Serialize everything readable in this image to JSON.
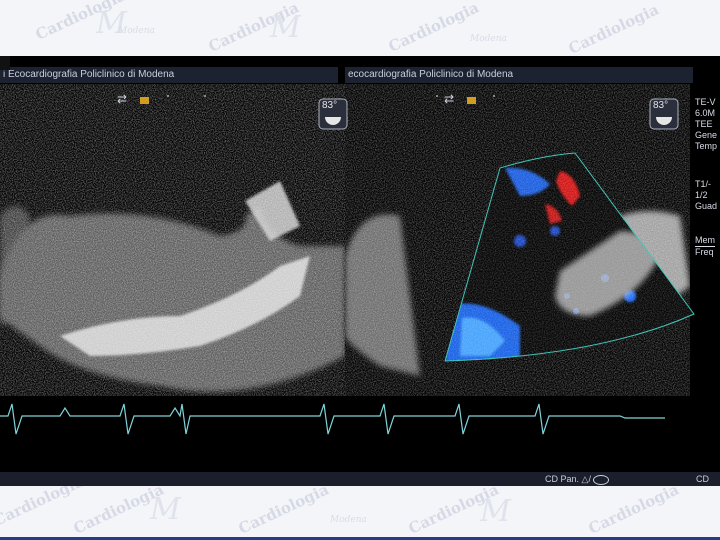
{
  "watermark": {
    "words": [
      "Cardiologia",
      "Modena",
      "Cardiologia",
      "Modena",
      "Cardiologia",
      "Modena",
      "Cardiologia",
      "Modena",
      "Cardiologia",
      "Modena"
    ],
    "logo_letter": "M",
    "color": "#d6dae6"
  },
  "left_panel": {
    "header": "i Ecocardiografia Policlinico di Modena"
  },
  "right_panel": {
    "header": "ecocardiografia Policlinico di Modena",
    "angle": "83°"
  },
  "left_angle": "83°",
  "side_info": {
    "lines": [
      "TE-V",
      "6.0M",
      "TEE",
      "Gene",
      "Temp",
      "T1/-",
      "1/2",
      "Guad",
      "Mem",
      "Freq"
    ]
  },
  "footer": {
    "cd_pan": "CD Pan.",
    "cd_short": "CD"
  },
  "colors": {
    "ecg": "#7fd3d8",
    "doppler_blue": "#1f6dff",
    "doppler_red": "#d41616",
    "sector_outline": "#41c6b8",
    "accent_bar": "#273b86"
  }
}
